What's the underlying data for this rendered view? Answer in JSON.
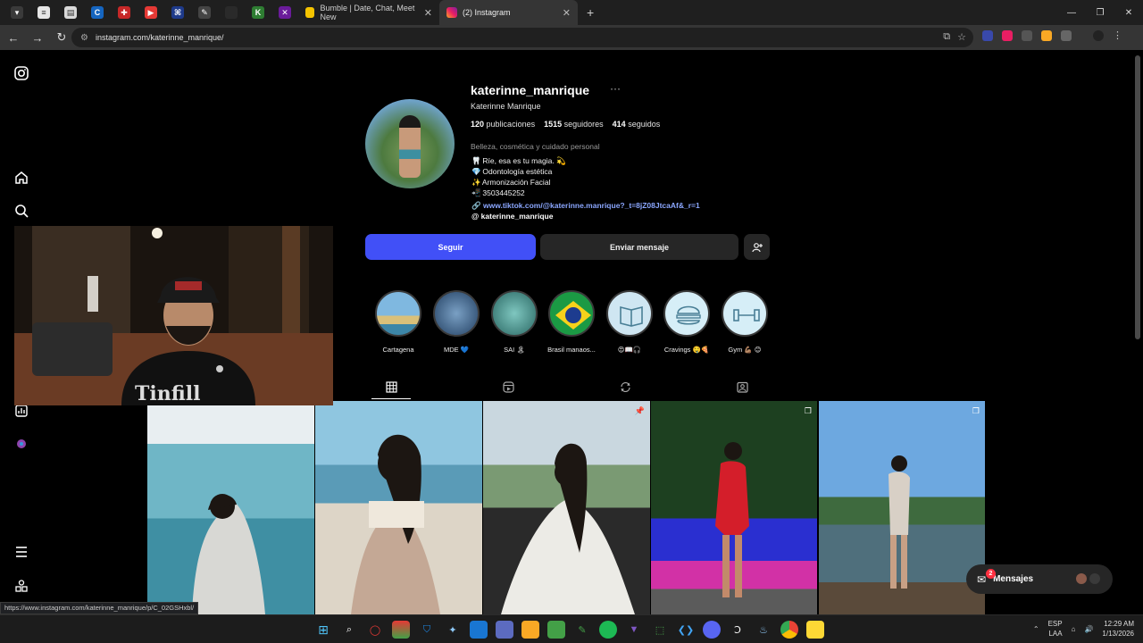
{
  "browser": {
    "tabs": [
      {
        "label": "Bumble | Date, Chat, Meet New",
        "active": false
      },
      {
        "label": "(2) Instagram",
        "active": true
      }
    ],
    "url": "instagram.com/katerinne_manrique/"
  },
  "profile": {
    "username": "katerinne_manrique",
    "full_name": "Katerinne Manrique",
    "stats": {
      "posts_count": "120",
      "posts_label": "publicaciones",
      "followers_count": "1515",
      "followers_label": "seguidores",
      "following_count": "414",
      "following_label": "seguidos"
    },
    "category": "Belleza, cosmética y cuidado personal",
    "bio": [
      {
        "emoji": "🦷",
        "text": "Ríe, esa es tu magia. 💫"
      },
      {
        "emoji": "💎",
        "text": "Odontología estética"
      },
      {
        "emoji": "✨",
        "text": "Armonización Facial"
      },
      {
        "emoji": "📲",
        "text": "3503445252"
      }
    ],
    "link": "www.tiktok.com/@katerinne.manrique?_t=8jZ08JtcaAf&_r=1",
    "threads": "katerinne_manrique"
  },
  "actions": {
    "follow": "Seguir",
    "message": "Enviar mensaje",
    "suggest_icon": "add-person-icon"
  },
  "highlights": [
    {
      "label": "Cartagena",
      "color": "#6fa7c9"
    },
    {
      "label": "MDE 💙",
      "color": "#5a7fa3"
    },
    {
      "label": "SAI 🏝",
      "color": "#4c8f9d"
    },
    {
      "label": "Brasil manaos...",
      "color": "#1d8f3c"
    },
    {
      "label": "😍📖🎧",
      "color": "#cfe6f2"
    },
    {
      "label": "Cravings 🤤🍕",
      "color": "#d6eef7"
    },
    {
      "label": "Gym 💪🏽 😊",
      "color": "#d6eef7"
    }
  ],
  "messages": {
    "label": "Mensajes",
    "count": "2"
  },
  "status_url": "https://www.instagram.com/katerinne_manrique/p/C_02GSHxbl/",
  "taskbar": {
    "lang": "ESP",
    "layout": "LAA",
    "time": "12:29 AM",
    "date": "1/13/2026"
  }
}
